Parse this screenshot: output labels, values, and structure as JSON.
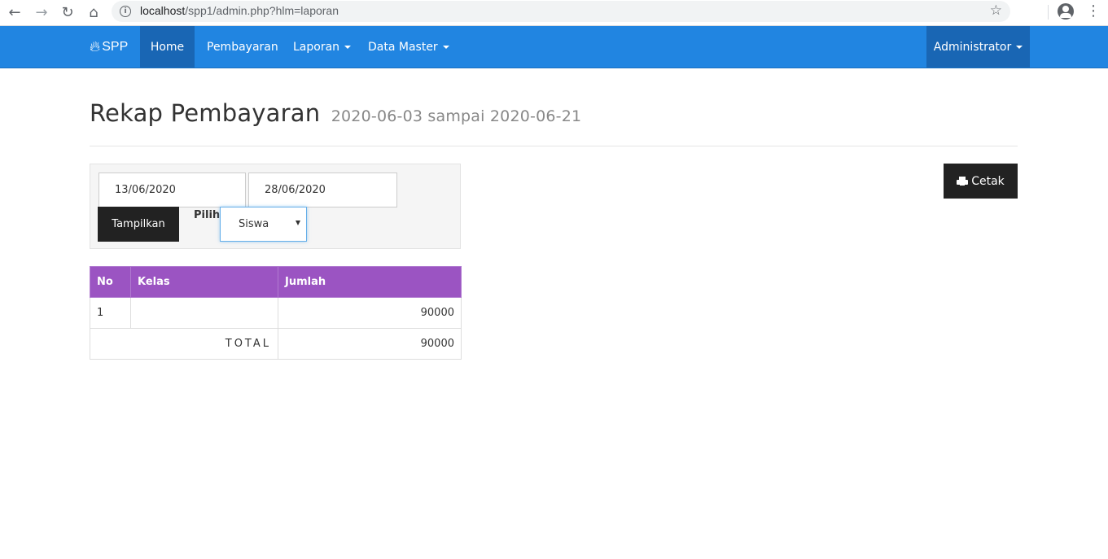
{
  "browser": {
    "url_host": "localhost",
    "url_path": "/spp1/admin.php?hlm=laporan"
  },
  "navbar": {
    "brand": "SPP",
    "items": [
      {
        "label": "Home",
        "active": true
      },
      {
        "label": "Pembayaran",
        "active": false
      },
      {
        "label": "Laporan",
        "active": false,
        "dropdown": true
      },
      {
        "label": "Data Master",
        "active": false,
        "dropdown": true
      }
    ],
    "user": "Administrator",
    "color": "#2185e1",
    "active_color": "#1966b4"
  },
  "page": {
    "title": "Rekap Pembayaran",
    "subtitle": "2020-06-03 sampai 2020-06-21"
  },
  "filter": {
    "date_from": "13/06/2020",
    "date_to": "28/06/2020",
    "show_button": "Tampilkan",
    "select_label": "Pilih",
    "select_value": "Siswa"
  },
  "print_button": "Cetak",
  "table": {
    "header_color": "#9b54c2",
    "headers": [
      "No",
      "Kelas",
      "Jumlah"
    ],
    "rows": [
      {
        "no": "1",
        "kelas": "",
        "jumlah": "90000"
      }
    ],
    "total_label": "TOTAL",
    "total_value": "90000"
  }
}
